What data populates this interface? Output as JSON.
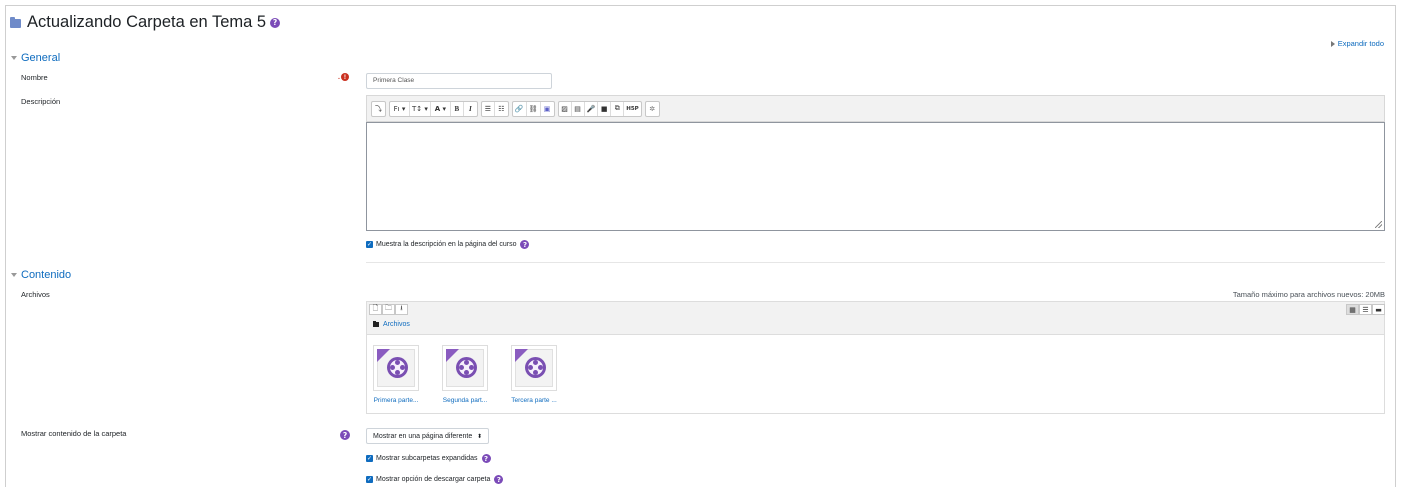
{
  "page": {
    "title": "Actualizando Carpeta en Tema 5",
    "expand_all": "Expandir todo"
  },
  "general": {
    "header": "General",
    "name_label": "Nombre",
    "name_value": "Primera Clase",
    "description_label": "Descripción",
    "show_description_label": "Muestra la descripción en la página del curso",
    "show_description_checked": true
  },
  "editor": {
    "toolbar": [
      {
        "name": "toolbar-toggle-button",
        "glyph": "⤵"
      },
      {
        "name": "font-family-button",
        "glyph": "Fı ▾"
      },
      {
        "name": "font-size-button",
        "glyph": "T↕ ▾"
      },
      {
        "name": "font-color-button",
        "glyph": "A ▾"
      },
      {
        "name": "bold-button",
        "glyph": "B"
      },
      {
        "name": "italic-button",
        "glyph": "I"
      },
      {
        "name": "unordered-list-button",
        "glyph": "☰"
      },
      {
        "name": "ordered-list-button",
        "glyph": "☷"
      },
      {
        "name": "link-button",
        "glyph": "🔗"
      },
      {
        "name": "unlink-button",
        "glyph": "⛓"
      },
      {
        "name": "teams-button",
        "glyph": "▣"
      },
      {
        "name": "image-button",
        "glyph": "▨"
      },
      {
        "name": "media-button",
        "glyph": "▤"
      },
      {
        "name": "record-audio-button",
        "glyph": "🎤"
      },
      {
        "name": "record-video-button",
        "glyph": "■"
      },
      {
        "name": "manage-files-button",
        "glyph": "⧉"
      },
      {
        "name": "h5p-button",
        "glyph": "H5P"
      },
      {
        "name": "accessibility-button",
        "glyph": "✲"
      }
    ]
  },
  "content": {
    "header": "Contenido",
    "files_label": "Archivos",
    "max_size": "Tamaño máximo para archivos nuevos: 20MB",
    "path": "Archivos",
    "files": [
      {
        "name": "Primera parte..."
      },
      {
        "name": "Segunda part..."
      },
      {
        "name": "Tercera parte ..."
      }
    ],
    "display_label": "Mostrar contenido de la carpeta",
    "display_value": "Mostrar en una página diferente",
    "display_arrow": "⬍",
    "show_subfolders_label": "Mostrar subcarpetas expandidas",
    "show_subfolders_checked": true,
    "show_download_label": "Mostrar opción de descargar carpeta",
    "show_download_checked": true
  },
  "colors": {
    "accent": "#0f6cbf",
    "help": "#7b4bb8",
    "required": "#ca3120"
  }
}
